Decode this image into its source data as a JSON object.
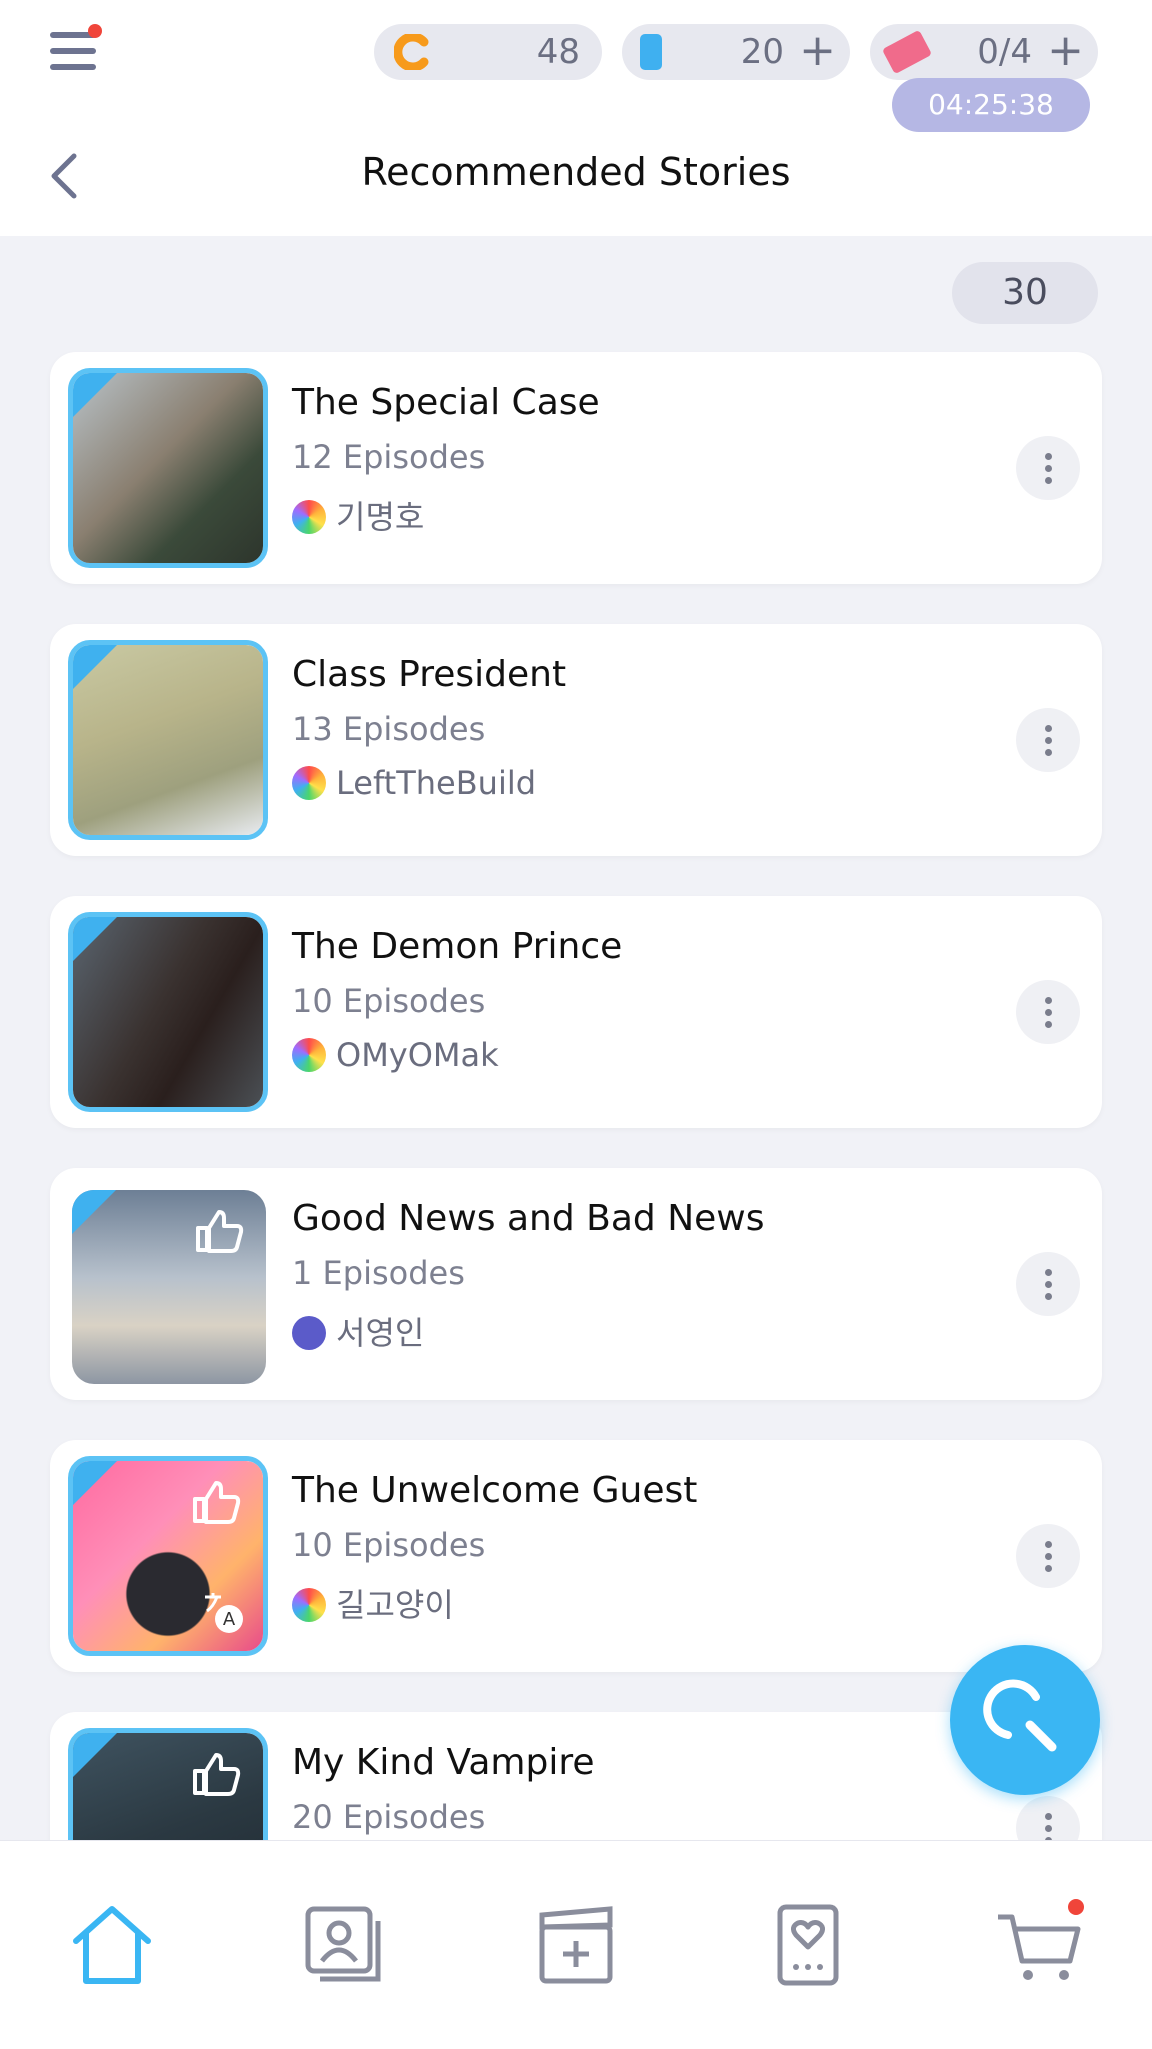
{
  "header": {
    "title": "Recommended Stories",
    "coins": "48",
    "gems": "20",
    "tickets": "0/4",
    "timer": "04:25:38",
    "plus": "+"
  },
  "list": {
    "count": "30",
    "items": [
      {
        "title": "The Special Case",
        "episodes": "12 Episodes",
        "author": "기명호"
      },
      {
        "title": "Class President",
        "episodes": "13 Episodes",
        "author": "LeftTheBuild"
      },
      {
        "title": "The Demon Prince",
        "episodes": "10 Episodes",
        "author": "OMyOMak"
      },
      {
        "title": "Good News and Bad News",
        "episodes": "1 Episodes",
        "author": "서영인"
      },
      {
        "title": "The Unwelcome Guest",
        "episodes": "10 Episodes",
        "author": "길고양이"
      },
      {
        "title": "My Kind Vampire",
        "episodes": "20 Episodes",
        "author": ""
      }
    ]
  },
  "colors": {
    "accent": "#3ab6f3",
    "background": "#f1f2f7",
    "badge_red": "#f0453a"
  },
  "tabs": [
    "home-icon",
    "profile-cards-icon",
    "clapperboard-add-icon",
    "heart-card-icon",
    "cart-icon"
  ]
}
